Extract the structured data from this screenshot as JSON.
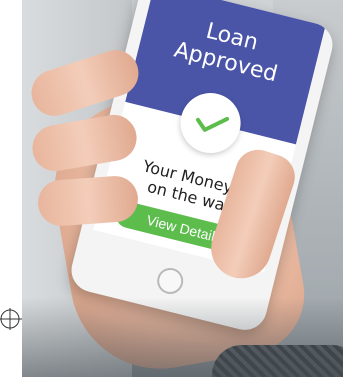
{
  "screen": {
    "title_line1": "Loan",
    "title_line2": "Approved",
    "message_line1": "Your Money is",
    "message_line2": "on the way.",
    "button_label": "View Details"
  },
  "colors": {
    "banner": "#4a55a8",
    "button": "#5cbd4c",
    "check": "#5cbd4c"
  },
  "icons": {
    "status": "checkmark-icon"
  }
}
